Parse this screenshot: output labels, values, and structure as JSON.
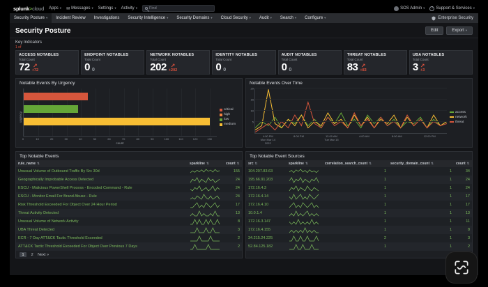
{
  "top_nav": {
    "logo_splunk": "splunk",
    "logo_gt": ">",
    "logo_cloud": "cloud",
    "apps": "Apps",
    "messages": "Messages",
    "settings": "Settings",
    "activity": "Activity",
    "find_placeholder": "Find",
    "user": "SOS Admin",
    "support": "Support & Services"
  },
  "subnav": {
    "items": [
      {
        "label": "Security Posture"
      },
      {
        "label": "Incident Review"
      },
      {
        "label": "Investigations"
      },
      {
        "label": "Security Intelligence"
      },
      {
        "label": "Security Domains"
      },
      {
        "label": "Cloud Security"
      },
      {
        "label": "Audit"
      },
      {
        "label": "Search"
      },
      {
        "label": "Configure"
      }
    ],
    "app_label": "Enterprise Security"
  },
  "page": {
    "title": "Security Posture",
    "edit_label": "Edit",
    "export_label": "Export"
  },
  "key_indicators": {
    "heading": "Key Indicators",
    "note": "1 of",
    "tiles": [
      {
        "title": "ACCESS NOTABLES",
        "subtitle": "Total Count",
        "value": "72",
        "delta": "+72",
        "trend": "up"
      },
      {
        "title": "ENDPOINT NOTABLES",
        "subtitle": "Total Count",
        "value": "0",
        "delta": "0",
        "trend": "flat"
      },
      {
        "title": "NETWORK NOTABLES",
        "subtitle": "Total Count",
        "value": "202",
        "delta": "+202",
        "trend": "up"
      },
      {
        "title": "IDENTITY NOTABLES",
        "subtitle": "Total Count",
        "value": "0",
        "delta": "0",
        "trend": "flat"
      },
      {
        "title": "AUDIT NOTABLES",
        "subtitle": "Total Count",
        "value": "0",
        "delta": "0",
        "trend": "flat"
      },
      {
        "title": "THREAT NOTABLES",
        "subtitle": "Total Count",
        "value": "83",
        "delta": "+83",
        "trend": "up"
      },
      {
        "title": "UBA NOTABLES",
        "subtitle": "Total Count",
        "value": "3",
        "delta": "+3",
        "trend": "up"
      }
    ]
  },
  "theme": {
    "delta_red": "#e0523d",
    "link_green": "#7cbb5c",
    "sparkline_green": "#7cbb5c",
    "panel_bg": "#1d1f23",
    "page_bg": "#141518"
  },
  "chart_data": [
    {
      "type": "bar",
      "orientation": "horizontal",
      "title": "Notable Events By Urgency",
      "categories": [
        "critical",
        "low",
        "medium"
      ],
      "values": [
        45,
        38,
        130
      ],
      "colors": [
        "#d6563c",
        "#65a637",
        "#f8be34"
      ],
      "xlabel": "count",
      "ylabel": "urgency",
      "xlim": [
        0,
        135
      ],
      "xtick_step": 10,
      "legend": [
        {
          "label": "critical",
          "color": "#d6563c"
        },
        {
          "label": "high",
          "color": "#f1813f"
        },
        {
          "label": "low",
          "color": "#65a637"
        },
        {
          "label": "medium",
          "color": "#f8be34"
        }
      ]
    },
    {
      "type": "line",
      "title": "Notable Events Over Time",
      "ylim": [
        0,
        20
      ],
      "yticks": [
        5,
        10,
        15,
        20
      ],
      "x_labels": [
        {
          "pos": 7,
          "lines": [
            "4:00 PM",
            "Mon Mar 14",
            "2022"
          ]
        },
        {
          "pos": 23,
          "lines": [
            "8:00 PM"
          ]
        },
        {
          "pos": 40,
          "lines": [
            "12:00 AM",
            "Tue Mar 15"
          ]
        },
        {
          "pos": 57,
          "lines": [
            "4:00 AM"
          ]
        },
        {
          "pos": 74,
          "lines": [
            "8:00 AM"
          ]
        },
        {
          "pos": 91,
          "lines": [
            "12:00 PM"
          ]
        }
      ],
      "legend_position": "right",
      "series": [
        {
          "name": "access",
          "color": "#65a637",
          "values": [
            2,
            5,
            3,
            7,
            2,
            6,
            4,
            8,
            3,
            6,
            2,
            7,
            4,
            9,
            3,
            6,
            2,
            8,
            4,
            7,
            3,
            6,
            2,
            5,
            4,
            7,
            2,
            6,
            3,
            5
          ]
        },
        {
          "name": "network",
          "color": "#f8be34",
          "values": [
            1,
            3,
            20,
            4,
            2,
            6,
            3,
            8,
            2,
            5,
            3,
            9,
            4,
            6,
            2,
            8,
            3,
            7,
            2,
            6,
            4,
            8,
            2,
            7,
            3,
            6,
            2,
            8,
            3,
            5
          ]
        },
        {
          "name": "threat",
          "color": "#d6563c",
          "values": [
            0,
            2,
            4,
            1,
            5,
            2,
            8,
            3,
            14,
            4,
            2,
            7,
            3,
            5,
            2,
            9,
            3,
            6,
            2,
            7,
            3,
            5,
            2,
            8,
            3,
            6,
            2,
            5,
            3,
            4
          ]
        }
      ]
    }
  ],
  "tables": {
    "events": {
      "title": "Top Notable Events",
      "columns": [
        "rule_name",
        "sparkline",
        "count"
      ],
      "rows": [
        {
          "rule": "Unusual Volume of Outbound Traffic By Src 30d",
          "count": "155",
          "spark": [
            12,
            28,
            16,
            34,
            20,
            38,
            18,
            42,
            24,
            36,
            18,
            40,
            22,
            30
          ]
        },
        {
          "rule": "Geographically Improbable Access Detected",
          "count": "24",
          "spark": [
            0,
            2,
            1,
            3,
            0,
            2,
            1,
            0,
            3,
            1,
            2,
            0,
            1,
            2
          ]
        },
        {
          "rule": "ESCU - Malicious PowerShell Process - Encoded Command - Rule",
          "count": "24",
          "spark": [
            1,
            0,
            2,
            1,
            3,
            0,
            1,
            2,
            0,
            1,
            3,
            0,
            2,
            1
          ]
        },
        {
          "rule": "ESCU - Monitor Email For Brand Abuse - Rule",
          "count": "24",
          "spark": [
            0,
            1,
            0,
            2,
            1,
            0,
            3,
            1,
            0,
            2,
            0,
            1,
            2,
            0
          ]
        },
        {
          "rule": "Risk Threshold Exceeded For Object Over 24 Hour Period",
          "count": "17",
          "spark": [
            0,
            0,
            1,
            2,
            0,
            1,
            0,
            2,
            1,
            0,
            1,
            2,
            0,
            1
          ]
        },
        {
          "rule": "Threat Activity Detected",
          "count": "13",
          "spark": [
            0,
            1,
            0,
            0,
            2,
            0,
            1,
            0,
            0,
            1,
            0,
            2,
            0,
            0
          ]
        },
        {
          "rule": "Unusual Volume of Network Activity",
          "count": "8",
          "spark": [
            0,
            0,
            1,
            0,
            1,
            0,
            0,
            1,
            0,
            1,
            0,
            0,
            1,
            0
          ]
        },
        {
          "rule": "UBA Threat Detected",
          "count": "3",
          "spark": [
            0,
            0,
            0,
            1,
            0,
            0,
            0,
            1,
            0,
            0,
            1,
            0,
            0,
            0
          ]
        },
        {
          "rule": "ECR - 7 Day ATT&CK Tactic Threshold Exceeded",
          "count": "2",
          "spark": [
            0,
            0,
            0,
            0,
            1,
            0,
            0,
            0,
            0,
            1,
            0,
            0,
            0,
            0
          ]
        },
        {
          "rule": "ATT&CK Tactic Threshold Exceeded For Object Over Previous 7 Days",
          "count": "2",
          "spark": [
            0,
            0,
            1,
            0,
            0,
            0,
            0,
            0,
            1,
            0,
            0,
            0,
            0,
            0
          ]
        }
      ],
      "pagination": {
        "pages": [
          "1",
          "2"
        ],
        "current": "1",
        "next_label": "Next »"
      }
    },
    "sources": {
      "title": "Top Notable Event Sources",
      "columns": [
        "src",
        "sparkline",
        "correlation_search_count",
        "security_domain_count",
        "count"
      ],
      "rows": [
        {
          "src": "104.207.83.63",
          "csc": "1",
          "sdc": "1",
          "count": "34",
          "spark": [
            4,
            7,
            3,
            8,
            5,
            9,
            4,
            7,
            3,
            8,
            4,
            6,
            3,
            7
          ]
        },
        {
          "src": "195.66.91.203",
          "csc": "1",
          "sdc": "1",
          "count": "24",
          "spark": [
            1,
            3,
            0,
            2,
            1,
            3,
            0,
            2,
            1,
            0,
            2,
            1,
            3,
            0
          ]
        },
        {
          "src": "172.16.4.3",
          "csc": "1",
          "sdc": "1",
          "count": "24",
          "spark": [
            0,
            2,
            1,
            3,
            0,
            2,
            1,
            0,
            3,
            1,
            0,
            2,
            1,
            0
          ]
        },
        {
          "src": "172.16.4.14",
          "csc": "1",
          "sdc": "1",
          "count": "17",
          "spark": [
            1,
            0,
            2,
            0,
            1,
            2,
            0,
            1,
            0,
            2,
            1,
            0,
            1,
            2
          ]
        },
        {
          "src": "172.16.4.10",
          "csc": "1",
          "sdc": "1",
          "count": "17",
          "spark": [
            0,
            1,
            2,
            0,
            1,
            0,
            2,
            1,
            0,
            1,
            2,
            0,
            1,
            0
          ]
        },
        {
          "src": "10.0.1.4",
          "csc": "1",
          "sdc": "1",
          "count": "13",
          "spark": [
            0,
            1,
            0,
            2,
            0,
            1,
            0,
            1,
            2,
            0,
            1,
            0,
            1,
            0
          ]
        },
        {
          "src": "172.16.3.147",
          "csc": "1",
          "sdc": "1",
          "count": "11",
          "spark": [
            1,
            0,
            1,
            0,
            2,
            0,
            1,
            0,
            1,
            0,
            2,
            0,
            1,
            0
          ]
        },
        {
          "src": "172.16.4.155",
          "csc": "1",
          "sdc": "1",
          "count": "8",
          "spark": [
            0,
            1,
            0,
            1,
            0,
            1,
            0,
            2,
            0,
            1,
            0,
            1,
            0,
            0
          ]
        },
        {
          "src": "34.215.24.225",
          "csc": "2",
          "sdc": "1",
          "count": "3",
          "spark": [
            0,
            0,
            1,
            0,
            0,
            1,
            0,
            0,
            1,
            0,
            0,
            0,
            1,
            0
          ]
        },
        {
          "src": "52.84.125.182",
          "csc": "1",
          "sdc": "1",
          "count": "2",
          "spark": [
            0,
            0,
            0,
            1,
            0,
            0,
            1,
            0,
            0,
            0,
            1,
            0,
            0,
            0
          ]
        }
      ]
    }
  }
}
